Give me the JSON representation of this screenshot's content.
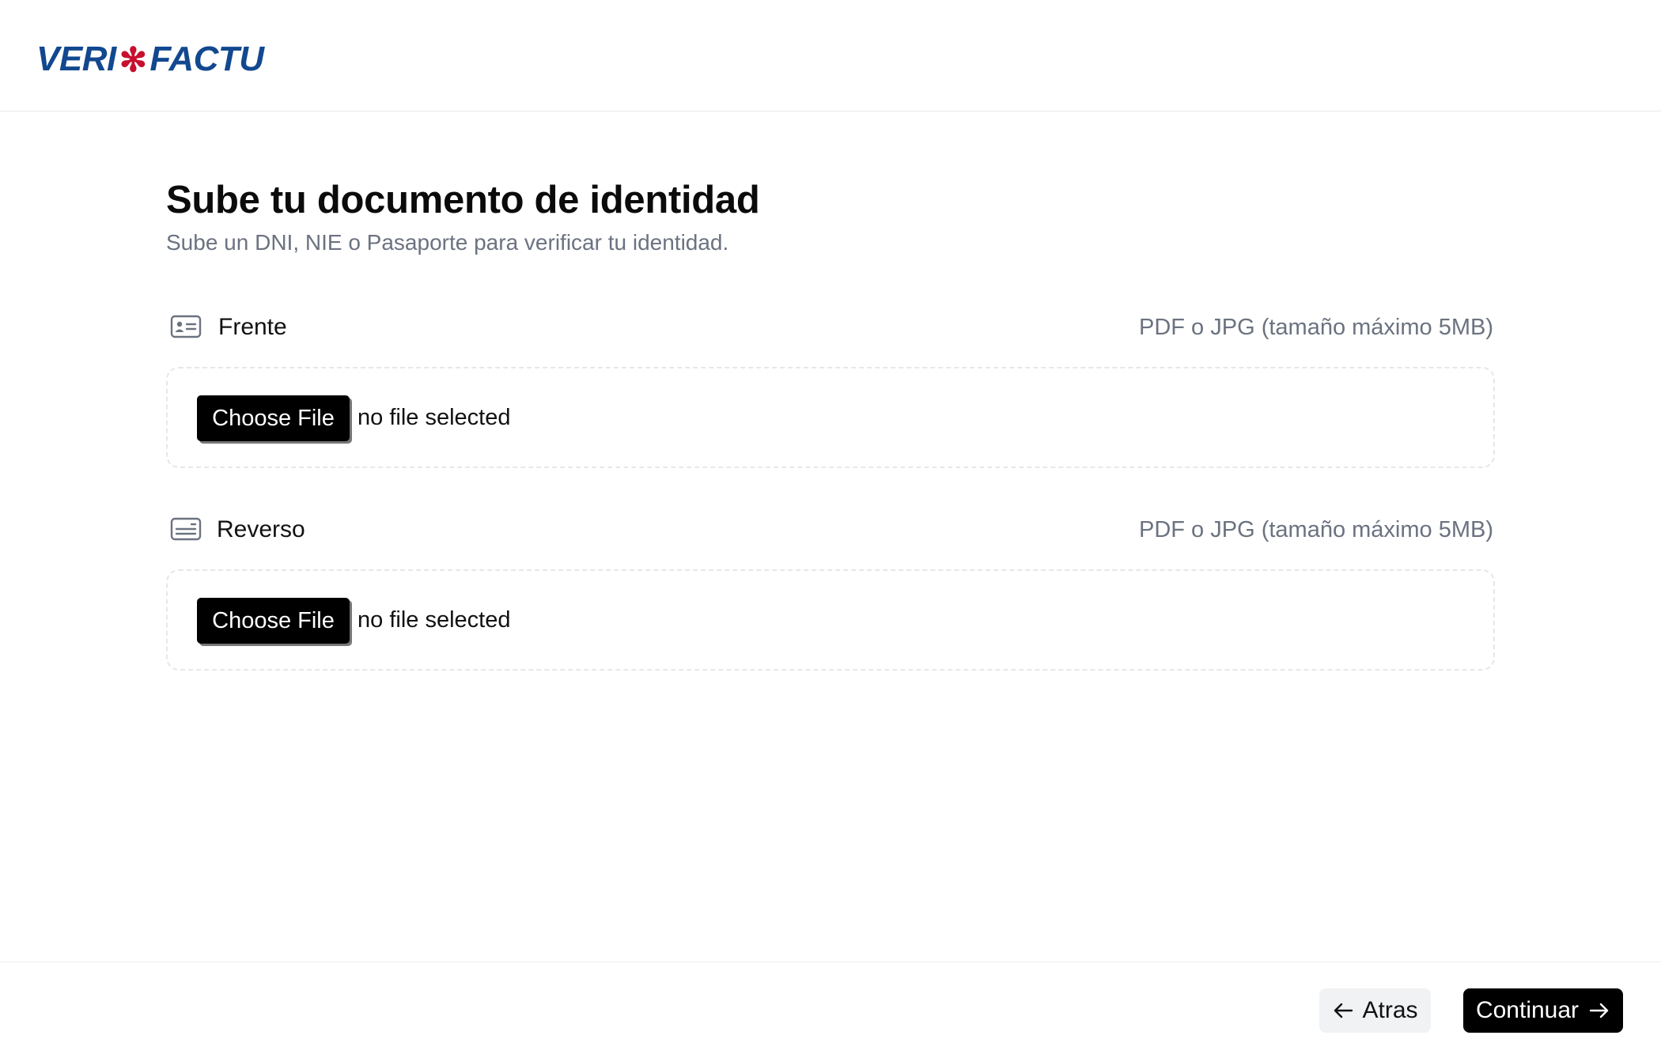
{
  "header": {
    "logo_left": "VERI",
    "logo_star": "✻",
    "logo_right": "FACTU"
  },
  "page": {
    "title": "Sube tu documento de identidad",
    "subtitle": "Sube un DNI, NIE o Pasaporte para verificar tu identidad."
  },
  "fields": [
    {
      "label": "Frente",
      "hint": "PDF o JPG (tamaño máximo 5MB)",
      "button_label": "Choose File",
      "status": "no file selected",
      "icon": "id-card-front-icon"
    },
    {
      "label": "Reverso",
      "hint": "PDF o JPG (tamaño máximo 5MB)",
      "button_label": "Choose File",
      "status": "no file selected",
      "icon": "id-card-back-icon"
    }
  ],
  "footer": {
    "back_label": "Atras",
    "next_label": "Continuar"
  },
  "colors": {
    "brand_blue": "#12488f",
    "brand_red": "#c8102e",
    "primary_button": "#000000",
    "secondary_button": "#f1f2f4",
    "muted_text": "#6b7280"
  }
}
